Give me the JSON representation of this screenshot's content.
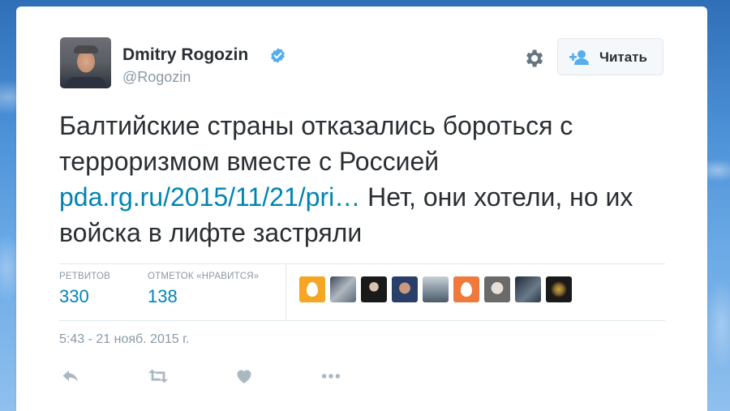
{
  "colors": {
    "link": "#0084b4",
    "text": "#292f33",
    "muted": "#8899a6",
    "verified": "#55acee",
    "icon": "#8899a6"
  },
  "author": {
    "name": "Dmitry Rogozin",
    "handle": "@Rogozin",
    "verified_icon": "verified-badge-icon"
  },
  "header": {
    "follow_label": "Читать",
    "follow_icon": "add-user-icon",
    "settings_icon": "gear-icon"
  },
  "tweet": {
    "text_part1": "Балтийские страны отказались бороться с терроризмом вместе с Россией ",
    "link_text": "pda.rg.ru/2015/11/21/pri…",
    "text_part2": " Нет, они хотели, но их войска в лифте застряли"
  },
  "stats": {
    "retweets_label": "РЕТВИТОВ",
    "retweets_value": "330",
    "likes_label": "ОТМЕТОК «НРАВИТСЯ»",
    "likes_value": "138"
  },
  "likers": [
    "default-egg-avatar-icon",
    "user-avatar",
    "user-avatar",
    "user-avatar",
    "user-avatar",
    "default-egg-avatar-icon",
    "user-avatar",
    "user-avatar",
    "user-avatar"
  ],
  "timestamp": "5:43 - 21 нояб. 2015 г.",
  "actions": [
    "reply-icon",
    "retweet-icon",
    "heart-icon",
    "more-icon"
  ]
}
